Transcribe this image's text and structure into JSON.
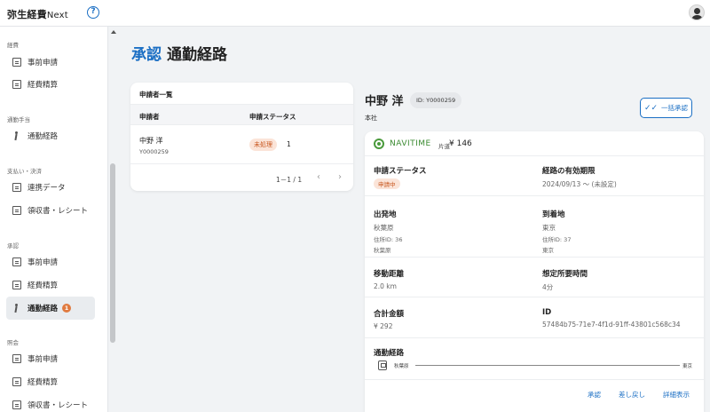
{
  "app": {
    "brand": "弥生経費",
    "brand_suffix": "Next",
    "help_icon": "?"
  },
  "sidebar": {
    "sections": [
      {
        "label": "経費",
        "items": [
          {
            "label": "事前申請"
          },
          {
            "label": "経費精算"
          }
        ]
      },
      {
        "label": "通勤手当",
        "items": [
          {
            "label": "通勤経路"
          }
        ]
      },
      {
        "label": "支払い・決済",
        "items": [
          {
            "label": "連携データ"
          },
          {
            "label": "領収書・レシート"
          }
        ]
      },
      {
        "label": "承認",
        "items": [
          {
            "label": "事前申請"
          },
          {
            "label": "経費精算"
          },
          {
            "label": "通勤経路",
            "badge": "1",
            "active": true
          }
        ]
      },
      {
        "label": "照会",
        "items": [
          {
            "label": "事前申請"
          },
          {
            "label": "経費精算"
          },
          {
            "label": "領収書・レシート"
          }
        ]
      }
    ]
  },
  "page": {
    "title_accent": "承認",
    "title": "通勤経路"
  },
  "list": {
    "title": "申請者一覧",
    "headers": [
      "申請者",
      "申請ステータス"
    ],
    "rows": [
      {
        "name": "中野 洋",
        "id": "Y0000259",
        "status": "未処理",
        "count": "1"
      }
    ],
    "pagination": "1－1 / 1",
    "prev_icon": "‹",
    "next_icon": "›"
  },
  "detail": {
    "name": "中野 洋",
    "id_label": "ID: Y0000259",
    "dept": "本社",
    "bulk_button": "一括承認",
    "provider": "NAVITIME",
    "trip_type": "片道",
    "fare": "¥ 146",
    "status_label": "申請ステータス",
    "status_value": "申請中",
    "validity_label": "経路の有効期限",
    "validity_value": "2024/09/13 〜 (未設定)",
    "from_label": "出発地",
    "from_value": "秋葉原",
    "from_station_id": "住所ID: 36",
    "from_station_name": "秋葉原",
    "to_label": "到着地",
    "to_value": "東京",
    "to_station_id": "住所ID: 37",
    "to_station_name": "東京",
    "distance_label": "移動距離",
    "distance_value": "2.0 km",
    "time_label": "想定所要時間",
    "time_value": "4分",
    "total_label": "合計金額",
    "total_value": "¥ 292",
    "id_title": "ID",
    "id_value": "57484b75-71e7-4f1d-91ff-43801c568c34",
    "route_label": "通勤経路",
    "route_from": "秋葉原",
    "route_to": "東京",
    "actions": {
      "approve": "承認",
      "return": "差し戻し",
      "details": "詳細表示"
    }
  },
  "colors": {
    "accent": "#1b6fc4",
    "badge": "#e07a3f",
    "chip_bg": "#fbe4d8",
    "chip_text": "#c8571f",
    "navitime": "#3b8b31"
  }
}
